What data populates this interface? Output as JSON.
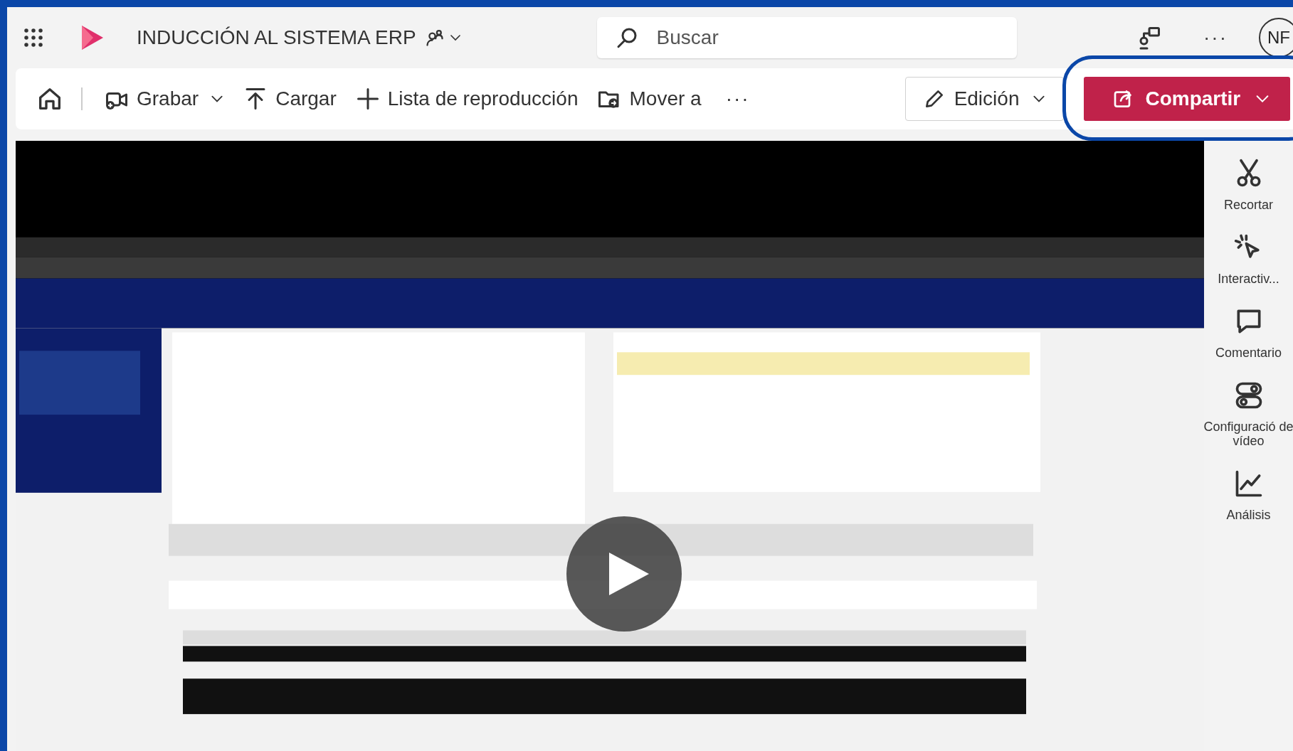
{
  "app_bar": {
    "title": "INDUCCIÓN AL SISTEMA ERP",
    "title_menu": true,
    "search": {
      "placeholder": "Buscar"
    },
    "more": "···",
    "avatar": "NF"
  },
  "toolbar": {
    "items": [
      {
        "kind": "record",
        "label": "Grabar",
        "dropdown": true
      },
      {
        "kind": "upload",
        "label": "Cargar",
        "dropdown": false
      },
      {
        "kind": "add",
        "label": "Lista de reproducción",
        "dropdown": false
      },
      {
        "kind": "move",
        "label": "Mover a",
        "dropdown": false
      }
    ],
    "more": "···",
    "edit": {
      "label": "Edición",
      "dropdown": true
    },
    "share": {
      "label": "Compartir",
      "dropdown": true,
      "highlighted": true
    }
  },
  "side_panel": {
    "items": [
      {
        "kind": "trim",
        "label": "Recortar"
      },
      {
        "kind": "interactive",
        "label": "Interactiv..."
      },
      {
        "kind": "comments",
        "label": "Comentario"
      },
      {
        "kind": "settings",
        "label": "Configuració de vídeo"
      },
      {
        "kind": "analytics",
        "label": "Análisis"
      }
    ]
  }
}
